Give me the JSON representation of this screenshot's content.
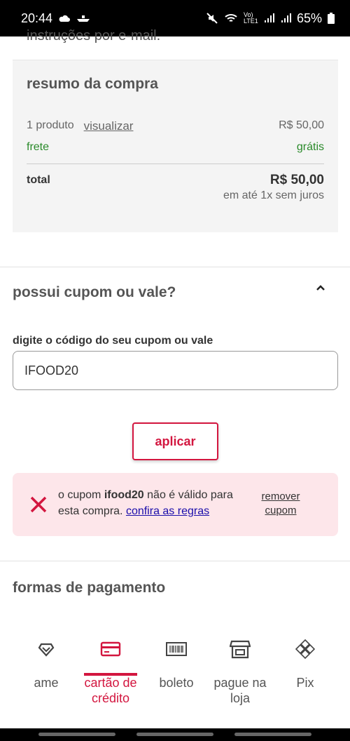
{
  "status_bar": {
    "time": "20:44",
    "network": "Vo) LTE1",
    "battery": "65%"
  },
  "clipped_text": "instruções por e-mail.",
  "summary": {
    "title": "resumo da compra",
    "product_count": "1 produto",
    "view_link": "visualizar",
    "product_price": "R$ 50,00",
    "shipping_label": "frete",
    "shipping_value": "grátis",
    "total_label": "total",
    "total_value": "R$ 50,00",
    "installments": "em até 1x sem juros"
  },
  "coupon": {
    "title": "possui cupom ou vale?",
    "field_label": "digite o código do seu cupom ou vale",
    "field_value": "IFOOD20",
    "apply_label": "aplicar",
    "error_prefix": "o cupom ",
    "error_code": "ifood20",
    "error_suffix": " não é válido para esta compra. ",
    "rules_link": "confira as regras",
    "remove_label": "remover cupom"
  },
  "payment": {
    "title": "formas de pagamento",
    "tabs": [
      {
        "label": "ame",
        "icon": "ame-heart-icon"
      },
      {
        "label": "cartão de crédito",
        "icon": "credit-card-icon"
      },
      {
        "label": "boleto",
        "icon": "barcode-icon"
      },
      {
        "label": "pague na loja",
        "icon": "store-icon"
      },
      {
        "label": "Pix",
        "icon": "pix-icon"
      }
    ],
    "active_tab": "cartão de crédito"
  },
  "colors": {
    "accent": "#d3163f",
    "success": "#2a8a2a",
    "error_bg": "#fde6ea",
    "link": "#1a0dab"
  }
}
